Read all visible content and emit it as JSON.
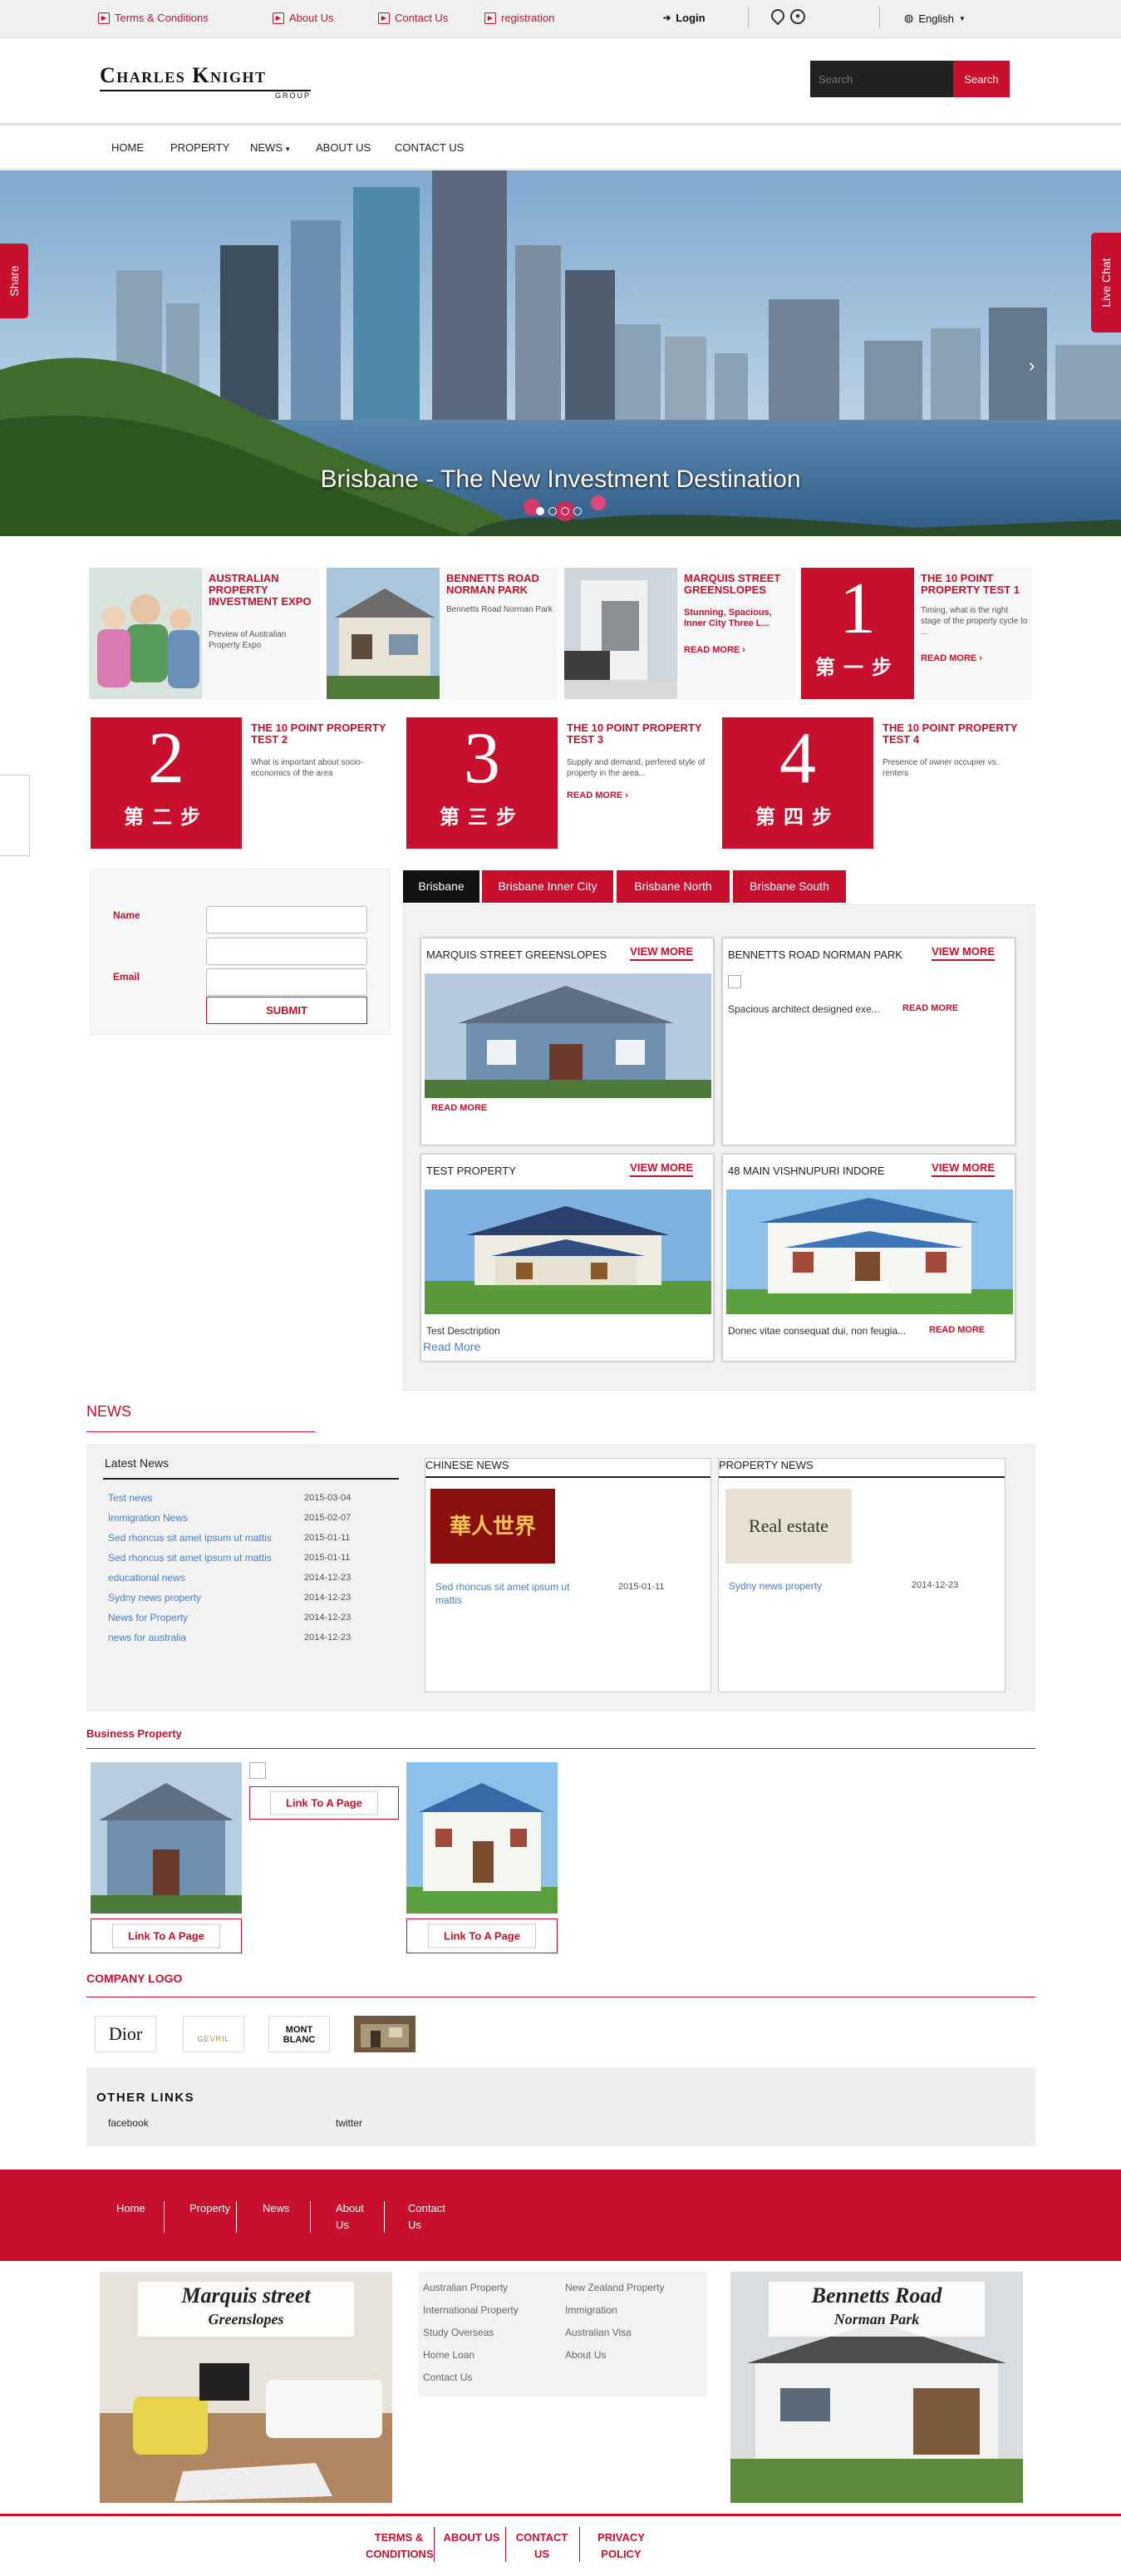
{
  "topbar": {
    "links": [
      "Terms & Conditions",
      "About Us",
      "Contact Us",
      "registration"
    ],
    "login": "Login",
    "language": "English"
  },
  "header": {
    "logo_main": "Charles Knight",
    "logo_sub": "GROUP",
    "search_placeholder": "Search",
    "search_button": "Search"
  },
  "nav": {
    "items": [
      "HOME",
      "PROPERTY",
      "NEWS",
      "ABOUT US",
      "CONTACT US"
    ]
  },
  "hero": {
    "caption": "Brisbane - The New Investment Destination",
    "share": "Share",
    "live_chat": "Live Chat",
    "slides": 4,
    "active_slide": 1
  },
  "promos": [
    {
      "title": "AUSTRALIAN PROPERTY INVESTMENT EXPO",
      "desc": "Preview of Australian Property Expo"
    },
    {
      "title": "BENNETTS ROAD NORMAN PARK",
      "desc": "Bennetts Road Norman Park"
    },
    {
      "title": "MARQUIS STREET GREENSLOPES",
      "desc": "Stunning, Spacious, Inner City Three L...",
      "read_more": "READ MORE"
    },
    {
      "title": "THE 10 POINT PROPERTY TEST 1",
      "desc": "Timing, what is the right stage of the property cycle to ...",
      "read_more": "READ MORE",
      "num": "1",
      "step": "第一步"
    }
  ],
  "steps": [
    {
      "num": "2",
      "step": "第二步",
      "title": "THE 10 POINT PROPERTY TEST 2",
      "desc": "What is important about socio-economics of the area"
    },
    {
      "num": "3",
      "step": "第三步",
      "title": "THE 10 POINT PROPERTY TEST 3",
      "desc": "Supply and demand, perfered style of property in the area...",
      "read_more": "READ MORE"
    },
    {
      "num": "4",
      "step": "第四步",
      "title": "THE 10 POINT PROPERTY TEST 4",
      "desc": "Presence of owner occupier vs. renters"
    }
  ],
  "form": {
    "name_label": "Name",
    "email_label": "Email",
    "submit": "SUBMIT"
  },
  "tabs": [
    "Brisbane",
    "Brisbane Inner City",
    "Brisbane North",
    "Brisbane South"
  ],
  "properties": [
    {
      "title": "MARQUIS STREET GREENSLOPES",
      "view_more": "VIEW MORE",
      "read_more": "READ MORE"
    },
    {
      "title": "BENNETTS ROAD NORMAN PARK",
      "view_more": "VIEW MORE",
      "desc": "Spacious architect designed  exe...",
      "read_more": "READ MORE"
    },
    {
      "title": "TEST PROPERTY",
      "view_more": "VIEW MORE",
      "desc": "Test Desctription",
      "read_more": "Read More"
    },
    {
      "title": "48 MAIN VISHNUPURI INDORE",
      "view_more": "VIEW MORE",
      "desc": "Donec vitae consequat dui, non feugia...",
      "read_more": "READ MORE"
    }
  ],
  "news": {
    "heading": "NEWS",
    "latest_title": "Latest News",
    "latest": [
      {
        "title": "Test news",
        "date": "2015-03-04"
      },
      {
        "title": "Immigration News",
        "date": "2015-02-07"
      },
      {
        "title": "Sed rhoncus sit amet ipsum ut mattis",
        "date": "2015-01-11"
      },
      {
        "title": "Sed rhoncus sit amet ipsum ut mattis",
        "date": "2015-01-11"
      },
      {
        "title": "educational news",
        "date": "2014-12-23"
      },
      {
        "title": "Sydny news property",
        "date": "2014-12-23"
      },
      {
        "title": "News for Property",
        "date": "2014-12-23"
      },
      {
        "title": "news for australia",
        "date": "2014-12-23"
      }
    ],
    "chinese_title": "CHINESE NEWS",
    "chinese_item": {
      "title": "Sed rhoncus sit amet ipsum ut mattis",
      "date": "2015-01-11",
      "img_text": "華人世界"
    },
    "property_title": "PROPERTY NEWS",
    "property_item": {
      "title": "Sydny news property",
      "date": "2014-12-23",
      "img_text": "Real estate"
    }
  },
  "business": {
    "title": "Business Property",
    "link_label": "Link To A Page"
  },
  "company_logo": {
    "title": "COMPANY LOGO",
    "logos": [
      "Dior",
      "GEVRIL",
      "MONT BLANC"
    ]
  },
  "other_links": {
    "title": "OTHER LINKS",
    "items": [
      "facebook",
      "twitter"
    ]
  },
  "footer": {
    "nav": [
      "Home",
      "Property",
      "News",
      "About Us",
      "Contact Us"
    ],
    "left_caption": {
      "line1": "Marquis street",
      "line2": "Greenslopes"
    },
    "right_caption": {
      "line1": "Bennetts Road",
      "line2": "Norman Park"
    },
    "links_col1": [
      "Australian Property",
      "International Property",
      "Study Overseas",
      "Home Loan",
      "Contact Us"
    ],
    "links_col2": [
      "New Zealand Property",
      "Immigration",
      "Australian Visa",
      "About Us"
    ],
    "bottom": [
      "TERMS & CONDITIONS",
      "ABOUT US",
      "CONTACT US",
      "PRIVACY POLICY"
    ]
  },
  "colors": {
    "accent": "#c8102e",
    "dark": "#111111"
  }
}
